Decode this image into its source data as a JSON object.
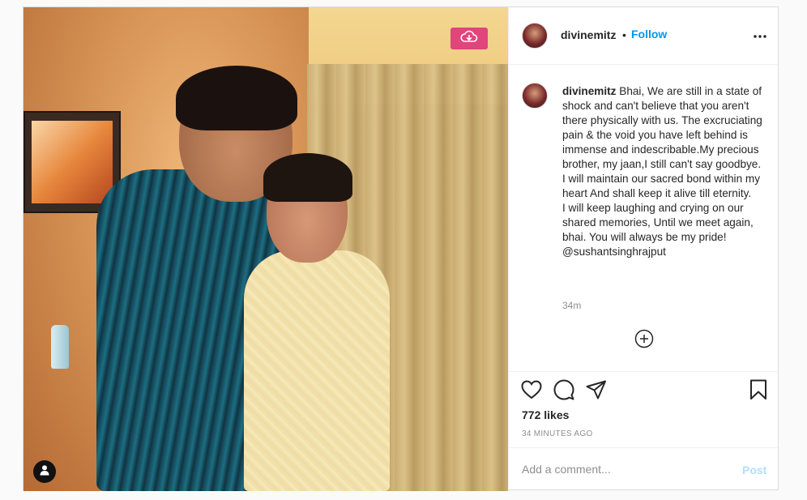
{
  "post": {
    "username": "divinemitz",
    "separator": "•",
    "follow_label": "Follow",
    "caption": "Bhai, We are still in a state of shock and can't believe that you aren't there physically with us. The excruciating pain & the void you have left behind is immense and indescribable.My precious brother, my jaan,I still can't say goodbye.\nI will maintain our sacred bond within my heart And shall keep it alive till eternity.\nI will keep laughing and crying on our shared memories, Until we meet again, bhai. You will always be my pride! @sushantsinghrajput",
    "caption_time": "34m",
    "likes": "772 likes",
    "time_ago": "34 MINUTES AGO"
  },
  "comment": {
    "placeholder": "Add a comment...",
    "post_label": "Post"
  },
  "colors": {
    "link": "#0095f6",
    "download_button": "#e0457b",
    "post_disabled": "#b2dffc"
  },
  "icons": {
    "download": "cloud-download-icon",
    "user_tag": "user-tag-icon",
    "more": "more-options-icon",
    "add": "add-circle-icon",
    "like": "heart-icon",
    "comment": "comment-icon",
    "share": "share-icon",
    "save": "bookmark-icon"
  }
}
